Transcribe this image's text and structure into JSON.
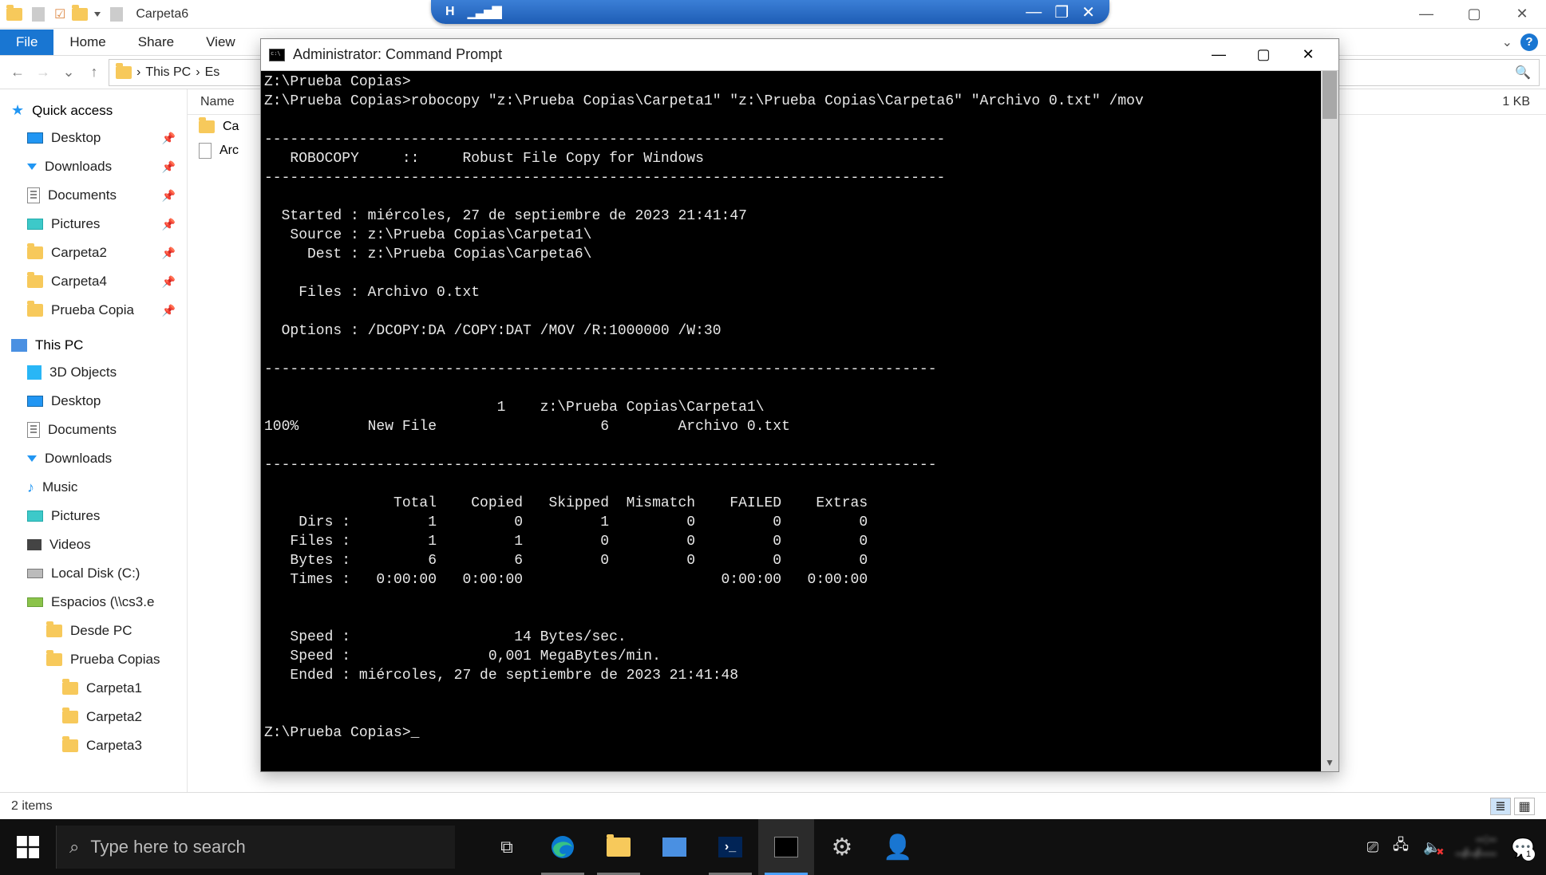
{
  "explorer": {
    "title": "Carpeta6",
    "ribbon": {
      "file": "File",
      "home": "Home",
      "share": "Share",
      "view": "View"
    },
    "breadcrumbs": [
      "This PC",
      "Es"
    ],
    "columns": {
      "name": "Name",
      "size": "1 KB"
    },
    "rows": [
      {
        "icon": "folder",
        "label": "Ca"
      },
      {
        "icon": "file",
        "label": "Arc"
      }
    ],
    "status": "2 items"
  },
  "nav": {
    "quick": "Quick access",
    "quick_items": [
      {
        "icon": "desktop",
        "label": "Desktop",
        "pinned": true
      },
      {
        "icon": "down",
        "label": "Downloads",
        "pinned": true
      },
      {
        "icon": "doc",
        "label": "Documents",
        "pinned": true
      },
      {
        "icon": "pic",
        "label": "Pictures",
        "pinned": true
      },
      {
        "icon": "folder",
        "label": "Carpeta2",
        "pinned": true
      },
      {
        "icon": "folder",
        "label": "Carpeta4",
        "pinned": true
      },
      {
        "icon": "folder",
        "label": "Prueba Copia",
        "pinned": true
      }
    ],
    "thispc": "This PC",
    "thispc_items": [
      {
        "icon": "3d",
        "label": "3D Objects"
      },
      {
        "icon": "desktop",
        "label": "Desktop"
      },
      {
        "icon": "doc",
        "label": "Documents"
      },
      {
        "icon": "down",
        "label": "Downloads"
      },
      {
        "icon": "music",
        "label": "Music"
      },
      {
        "icon": "pic",
        "label": "Pictures"
      },
      {
        "icon": "video",
        "label": "Videos"
      },
      {
        "icon": "hdd",
        "label": "Local Disk (C:)"
      },
      {
        "icon": "net",
        "label": "Espacios (\\\\cs3.e"
      }
    ],
    "sub_items": [
      {
        "icon": "folder",
        "label": "Desde PC",
        "ind": 2
      },
      {
        "icon": "folder",
        "label": "Prueba Copias",
        "ind": 2
      },
      {
        "icon": "folder",
        "label": "Carpeta1",
        "ind": 3
      },
      {
        "icon": "folder",
        "label": "Carpeta2",
        "ind": 3
      },
      {
        "icon": "folder",
        "label": "Carpeta3",
        "ind": 3
      }
    ]
  },
  "cmd": {
    "title": "Administrator: Command Prompt",
    "lines": [
      "Z:\\Prueba Copias>",
      "Z:\\Prueba Copias>robocopy \"z:\\Prueba Copias\\Carpeta1\" \"z:\\Prueba Copias\\Carpeta6\" \"Archivo 0.txt\" /mov",
      "",
      "-------------------------------------------------------------------------------",
      "   ROBOCOPY     ::     Robust File Copy for Windows",
      "-------------------------------------------------------------------------------",
      "",
      "  Started : miércoles, 27 de septiembre de 2023 21:41:47",
      "   Source : z:\\Prueba Copias\\Carpeta1\\",
      "     Dest : z:\\Prueba Copias\\Carpeta6\\",
      "",
      "    Files : Archivo 0.txt",
      "",
      "  Options : /DCOPY:DA /COPY:DAT /MOV /R:1000000 /W:30",
      "",
      "------------------------------------------------------------------------------",
      "",
      "                           1    z:\\Prueba Copias\\Carpeta1\\",
      "100%        New File                   6        Archivo 0.txt",
      "",
      "------------------------------------------------------------------------------",
      "",
      "               Total    Copied   Skipped  Mismatch    FAILED    Extras",
      "    Dirs :         1         0         1         0         0         0",
      "   Files :         1         1         0         0         0         0",
      "   Bytes :         6         6         0         0         0         0",
      "   Times :   0:00:00   0:00:00                       0:00:00   0:00:00",
      "",
      "",
      "   Speed :                   14 Bytes/sec.",
      "   Speed :                0,001 MegaBytes/min.",
      "   Ended : miércoles, 27 de septiembre de 2023 21:41:48",
      "",
      "",
      "Z:\\Prueba Copias>_"
    ]
  },
  "taskbar": {
    "search_placeholder": "Type here to search",
    "notif_count": "1"
  }
}
